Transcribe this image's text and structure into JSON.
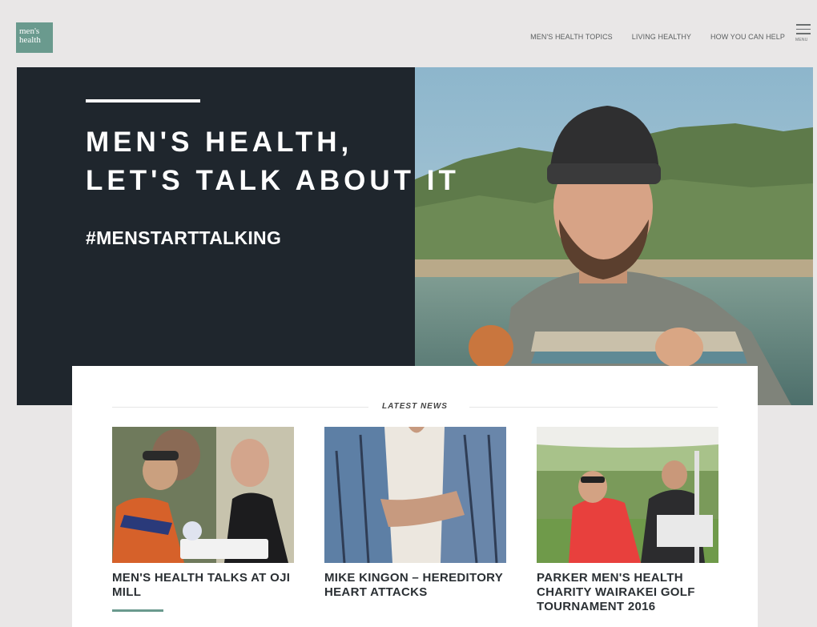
{
  "header": {
    "logo_line1": "men's",
    "logo_line2": "health",
    "nav": [
      "MEN'S HEALTH TOPICS",
      "LIVING HEALTHY",
      "HOW YOU CAN HELP"
    ],
    "menu_label": "MENU"
  },
  "hero": {
    "title_line1": "MEN'S HEALTH,",
    "title_line2": "LET'S TALK ABOUT IT",
    "hashtag": "#MENSTARTTALKING"
  },
  "news": {
    "heading": "LATEST NEWS",
    "items": [
      {
        "title": "MEN'S HEALTH TALKS AT OJI MILL"
      },
      {
        "title": "MIKE KINGON – HEREDITORY HEART ATTACKS"
      },
      {
        "title": "PARKER MEN'S HEALTH CHARITY WAIRAKEI GOLF TOURNAMENT 2016"
      }
    ]
  },
  "colors": {
    "accent": "#6a9a8e",
    "hero_dark": "#1f262d",
    "page_bg": "#e9e7e7"
  }
}
